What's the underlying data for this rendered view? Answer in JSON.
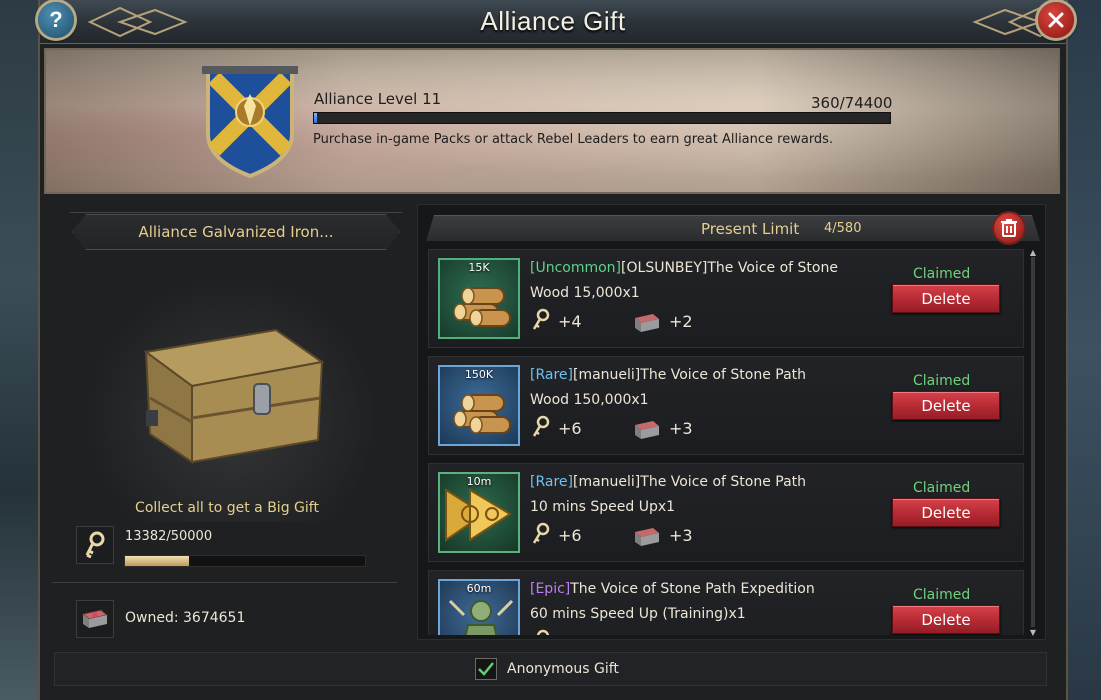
{
  "window": {
    "title": "Alliance Gift",
    "help_symbol": "?",
    "close_symbol": "close-icon"
  },
  "banner": {
    "level_label": "Alliance Level 11",
    "level_value": "360/74400",
    "level_progress": 0.0048,
    "description": "Purchase in-game Packs or attack Rebel Leaders to earn great Alliance rewards."
  },
  "left": {
    "chest_name": "Alliance Galvanized Iron...",
    "collect_text": "Collect all to get a Big Gift",
    "key_count": "13382/50000",
    "key_progress": 0.2676,
    "owned": "Owned: 3674651"
  },
  "right": {
    "limit_label": "Present Limit",
    "limit_value": "4/580",
    "gifts": [
      {
        "tag": "15K",
        "rarity": "[Uncommon]",
        "rarity_class": "rar-unc",
        "title": "[OLSUNBEY]The Voice of Stone",
        "item": "Wood 15,000x1",
        "keys": "+4",
        "chests": "+2",
        "status": "Claimed",
        "button": "Delete",
        "icon": "wood-logs-icon",
        "frame": "green"
      },
      {
        "tag": "150K",
        "rarity": "[Rare]",
        "rarity_class": "rar-rare",
        "title": "[manueli]The Voice of Stone Path",
        "item": "Wood 150,000x1",
        "keys": "+6",
        "chests": "+3",
        "status": "Claimed",
        "button": "Delete",
        "icon": "wood-logs-icon",
        "frame": "blue"
      },
      {
        "tag": "10m",
        "rarity": "[Rare]",
        "rarity_class": "rar-rare",
        "title": "[manueli]The Voice of Stone Path",
        "item": "10 mins Speed Upx1",
        "keys": "+6",
        "chests": "+3",
        "status": "Claimed",
        "button": "Delete",
        "icon": "speedup-arrow-icon",
        "frame": "gold"
      },
      {
        "tag": "60m",
        "rarity": "[Epic]",
        "rarity_class": "rar-epic",
        "title": "The Voice of Stone Path Expedition",
        "item": "60 mins Speed Up (Training)x1",
        "keys": "",
        "chests": "",
        "status": "Claimed",
        "button": "Delete",
        "icon": "training-speedup-icon",
        "frame": "purple"
      }
    ]
  },
  "footer": {
    "anonymous_label": "Anonymous Gift",
    "anonymous_checked": true
  },
  "colors": {
    "accent_gold": "#e6cf8e",
    "claimed_green": "#6fd27b",
    "delete_red": "#b52a33",
    "uncommon": "#5cd48a",
    "rare": "#6cc3f5",
    "epic": "#c07cf5"
  }
}
